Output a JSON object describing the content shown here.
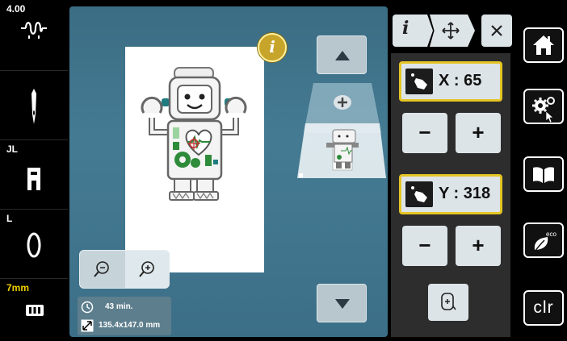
{
  "left_bar": {
    "tension_value": "4.00",
    "presser_foot": "JL",
    "stitch_plate": "L",
    "stitch_length": "7mm"
  },
  "canvas": {
    "info_button_label": "i",
    "stitch_time": "43 min.",
    "design_size": "135.4x147.0 mm"
  },
  "right_panel": {
    "info_tab_label": "i",
    "x_label": "X : 65",
    "y_label": "Y : 318",
    "minus_label": "−",
    "plus_label": "+"
  },
  "right_bar": {
    "clr_label": "clr"
  },
  "colors": {
    "accent_yellow": "#e4c524",
    "canvas_blue": "#447b93",
    "robot_green": "#2e8b3a",
    "robot_teal": "#1f7c80"
  }
}
